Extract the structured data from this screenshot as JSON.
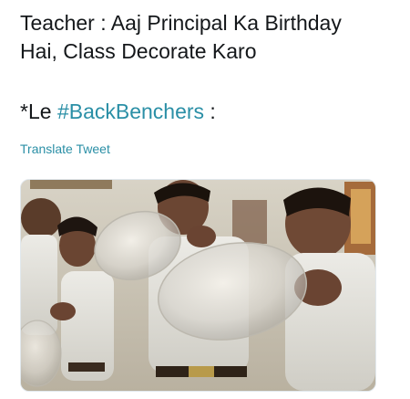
{
  "tweet": {
    "text_line1": "Teacher : Aaj Principal Ka Birthday",
    "text_line2": "Hai, Class Decorate Karo",
    "reply_prefix": "*Le ",
    "hashtag": "#BackBenchers",
    "reply_suffix": " :",
    "translate_label": "Translate Tweet"
  },
  "colors": {
    "text": "#14171a",
    "link": "#2a8fa6"
  },
  "media": {
    "description_icon": "photo-image"
  }
}
